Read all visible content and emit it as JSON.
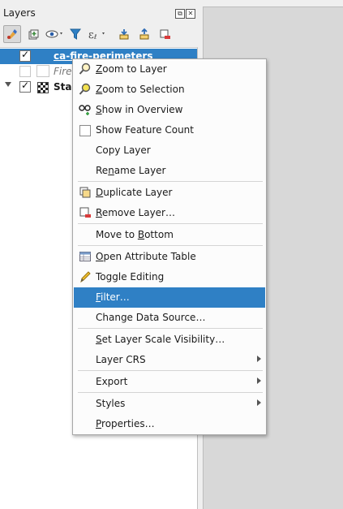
{
  "panel": {
    "title": "Layers"
  },
  "titlebar_buttons": [
    {
      "name": "float-icon",
      "glyph": "⧉"
    },
    {
      "name": "close-icon",
      "glyph": "✕"
    }
  ],
  "toolbar": {
    "items": [
      {
        "name": "style-manager-icon"
      },
      {
        "name": "add-group-icon"
      },
      {
        "name": "visibility-icon"
      },
      {
        "name": "filter-legend-icon"
      },
      {
        "name": "filter-expression-icon"
      },
      {
        "name": "expand-all-icon"
      },
      {
        "name": "collapse-all-icon"
      },
      {
        "name": "remove-layer-icon"
      }
    ]
  },
  "layers": [
    {
      "label": "ca-fire-perimeters",
      "checked": true,
      "selected": true
    },
    {
      "label": "Fire",
      "checked": false,
      "selected": false
    },
    {
      "label": "Star",
      "checked": true,
      "selected": false
    }
  ],
  "context_menu": {
    "zoom_to_layer": {
      "pre": "",
      "key": "Z",
      "post": "oom to Layer"
    },
    "zoom_to_selection": {
      "pre": "",
      "key": "Z",
      "post": "oom to Selection"
    },
    "show_in_overview": {
      "pre": "",
      "key": "S",
      "post": "how in Overview"
    },
    "show_feature_count": {
      "label": "Show Feature Count"
    },
    "copy_layer": {
      "label": "Copy Layer"
    },
    "rename_layer": {
      "pre": "Re",
      "key": "n",
      "post": "ame Layer"
    },
    "duplicate_layer": {
      "pre": "",
      "key": "D",
      "post": "uplicate Layer"
    },
    "remove_layer": {
      "pre": "",
      "key": "R",
      "post": "emove Layer…"
    },
    "move_to_bottom": {
      "pre": "Move to ",
      "key": "B",
      "post": "ottom"
    },
    "open_attribute_table": {
      "pre": "",
      "key": "O",
      "post": "pen Attribute Table"
    },
    "toggle_editing": {
      "label": "Toggle Editing"
    },
    "filter": {
      "pre": "",
      "key": "F",
      "post": "ilter…"
    },
    "change_data_source": {
      "label": "Change Data Source…"
    },
    "set_scale_visibility": {
      "pre": "",
      "key": "S",
      "post": "et Layer Scale Visibility…"
    },
    "layer_crs": {
      "label": "Layer CRS"
    },
    "export": {
      "label": "Export"
    },
    "styles": {
      "label": "Styles"
    },
    "properties": {
      "pre": "",
      "key": "P",
      "post": "roperties…"
    }
  },
  "colors": {
    "selection": "#2f80c5",
    "menu_bg": "#fcfcfc",
    "panel_bg": "#efefef"
  }
}
